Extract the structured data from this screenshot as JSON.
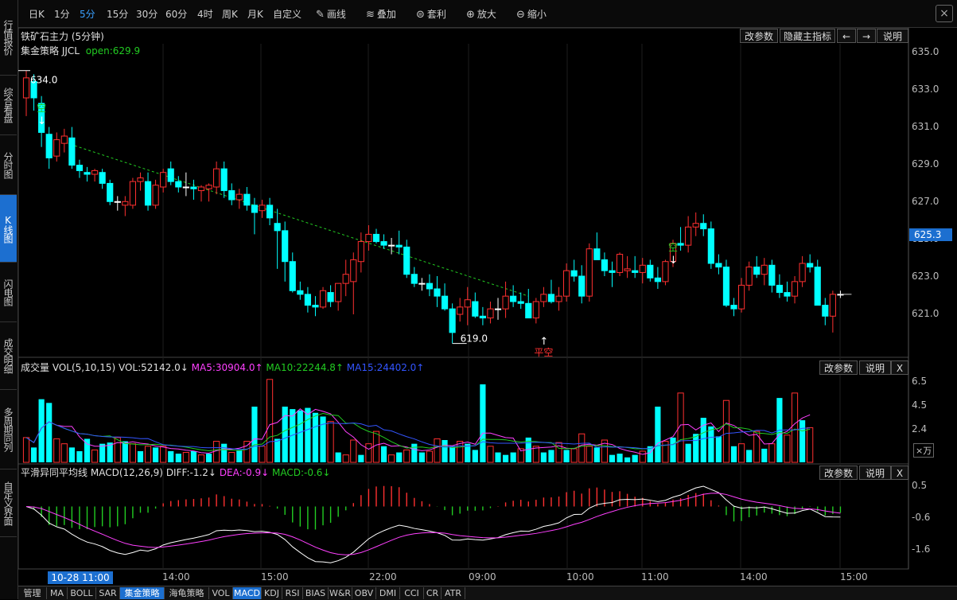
{
  "left_sidebar": [
    "行情报价",
    "综合看盘",
    "分时图",
    "K线图",
    "闪电图",
    "成交明细",
    "多周期同列",
    "自定义界面"
  ],
  "toolbar": {
    "periods": [
      "日K",
      "1分",
      "5分",
      "15分",
      "30分",
      "60分",
      "4时",
      "周K",
      "月K",
      "自定义"
    ],
    "active_period": "5分",
    "tools": [
      {
        "icon": "pencil-icon",
        "label": "画线"
      },
      {
        "icon": "stack-icon",
        "label": "叠加"
      },
      {
        "icon": "arbitrage-icon",
        "label": "套利"
      },
      {
        "icon": "zoom-in-icon",
        "label": "放大"
      },
      {
        "icon": "zoom-out-icon",
        "label": "缩小"
      }
    ],
    "close": "×"
  },
  "main_panel": {
    "title": "铁矿石主力 (5分钟)",
    "strategy_label": "集金策略 JJCL",
    "open_label": "open:629.9",
    "buttons": [
      "改参数",
      "隐藏主指标",
      "←",
      "→",
      "说明"
    ],
    "y_axis": [
      "635.0",
      "633.0",
      "631.0",
      "629.0",
      "627.0",
      "625.0",
      "623.0",
      "621.0"
    ],
    "current_price": "625.3",
    "high_label": "634.0",
    "low_label": "619.0",
    "signals": [
      {
        "text": "空",
        "arrow": "↓",
        "color": "#22cc22"
      },
      {
        "text": "空",
        "arrow": "↓",
        "color": "#22cc22"
      },
      {
        "text": "平空",
        "arrow": "↑",
        "color": "#ff3030"
      }
    ]
  },
  "volume_panel": {
    "name": "成交量",
    "params": "VOL(5,10,15)",
    "vol": "VOL:52142.0↓",
    "ma5": "MA5:30904.0↑",
    "ma10": "MA10:22244.8↑",
    "ma15": "MA15:24402.0↑",
    "buttons": [
      "改参数",
      "说明",
      "X"
    ],
    "y_axis": [
      "6.5",
      "4.5",
      "2.4"
    ],
    "unit": "×万"
  },
  "macd_panel": {
    "name": "平滑异同平均线",
    "params": "MACD(12,26,9)",
    "diff": "DIFF:-1.2↓",
    "dea": "DEA:-0.9↓",
    "macd": "MACD:-0.6↓",
    "buttons": [
      "改参数",
      "说明",
      "X"
    ],
    "y_axis": [
      "0.5",
      "-0.6",
      "-1.6"
    ]
  },
  "time_axis": {
    "cursor": "10-28 11:00",
    "labels": [
      "14:00",
      "15:00",
      "22:00",
      "09:00",
      "10:00",
      "11:00",
      "14:00",
      "15:00"
    ]
  },
  "bottom_tabs": [
    "管理",
    "MA",
    "BOLL",
    "SAR",
    "集金策略",
    "海龟策略",
    "VOL",
    "MACD",
    "KDJ",
    "RSI",
    "BIAS",
    "W&R",
    "OBV",
    "DMI",
    "CCI",
    "CR",
    "ATR"
  ],
  "active_tabs": [
    "集金策略",
    "MACD"
  ],
  "colors": {
    "up": "#ff3030",
    "down": "#00ffff",
    "diff": "#ffffff",
    "dea": "#ff40ff",
    "ma10": "#22cc22",
    "ma15": "#3355ff",
    "accent": "#1c6fd0"
  },
  "chart_data": {
    "type": "candlestick",
    "ohlc": [
      [
        632.5,
        634.0,
        631.5,
        633.6
      ],
      [
        633.4,
        633.8,
        631.8,
        632.5
      ],
      [
        632.2,
        632.6,
        629.8,
        630.6
      ],
      [
        630.5,
        630.9,
        628.6,
        629.2
      ],
      [
        629.3,
        630.6,
        629.0,
        630.2
      ],
      [
        630.0,
        630.8,
        629.5,
        630.4
      ],
      [
        630.3,
        630.9,
        628.6,
        628.8
      ],
      [
        628.8,
        629.1,
        628.1,
        628.5
      ],
      [
        628.4,
        628.7,
        627.9,
        628.3
      ],
      [
        628.3,
        628.6,
        627.9,
        628.5
      ],
      [
        628.4,
        628.6,
        627.5,
        627.8
      ],
      [
        627.8,
        628.0,
        626.6,
        626.8
      ],
      [
        626.8,
        627.1,
        626.3,
        626.8
      ],
      [
        626.6,
        627.1,
        626.0,
        626.8
      ],
      [
        626.6,
        628.1,
        626.4,
        627.9
      ],
      [
        627.9,
        628.4,
        627.4,
        628.1
      ],
      [
        627.9,
        628.4,
        626.3,
        626.6
      ],
      [
        626.6,
        628.0,
        626.4,
        627.7
      ],
      [
        627.6,
        628.6,
        627.3,
        628.4
      ],
      [
        628.6,
        629.0,
        627.7,
        627.9
      ],
      [
        627.9,
        628.2,
        627.3,
        627.6
      ],
      [
        627.6,
        628.4,
        627.1,
        627.6
      ],
      [
        627.6,
        628.0,
        626.9,
        627.5
      ],
      [
        627.4,
        627.7,
        626.8,
        627.6
      ],
      [
        627.5,
        627.8,
        626.8,
        627.7
      ],
      [
        627.6,
        629.0,
        627.2,
        628.6
      ],
      [
        628.6,
        629.0,
        627.0,
        627.4
      ],
      [
        627.4,
        627.8,
        626.6,
        626.9
      ],
      [
        626.9,
        627.5,
        626.4,
        627.2
      ],
      [
        627.2,
        627.6,
        626.3,
        626.6
      ],
      [
        626.6,
        627.0,
        625.0,
        626.2
      ],
      [
        626.3,
        626.9,
        625.9,
        626.6
      ],
      [
        626.6,
        627.0,
        625.5,
        625.9
      ],
      [
        625.6,
        626.4,
        623.1,
        625.2
      ],
      [
        625.2,
        625.7,
        622.4,
        623.5
      ],
      [
        623.5,
        624.0,
        621.8,
        621.9
      ],
      [
        621.9,
        622.4,
        621.4,
        621.7
      ],
      [
        621.7,
        622.1,
        620.7,
        621.1
      ],
      [
        621.1,
        621.6,
        620.5,
        621.0
      ],
      [
        621.0,
        622.1,
        620.9,
        621.9
      ],
      [
        621.8,
        622.2,
        621.0,
        621.3
      ],
      [
        621.3,
        622.3,
        620.8,
        622.3
      ],
      [
        622.3,
        623.6,
        621.6,
        622.8
      ],
      [
        622.4,
        624.0,
        620.6,
        623.6
      ],
      [
        623.5,
        625.1,
        622.9,
        624.6
      ],
      [
        624.6,
        625.5,
        624.1,
        625.0
      ],
      [
        625.0,
        625.3,
        624.5,
        624.6
      ],
      [
        624.6,
        625.0,
        624.2,
        624.4
      ],
      [
        624.4,
        624.8,
        623.9,
        624.4
      ],
      [
        624.4,
        625.2,
        623.9,
        624.3
      ],
      [
        624.3,
        624.7,
        622.6,
        622.8
      ],
      [
        622.8,
        623.2,
        622.1,
        622.3
      ],
      [
        622.3,
        622.6,
        621.9,
        622.3
      ],
      [
        622.3,
        622.8,
        621.6,
        622.0
      ],
      [
        622.0,
        622.7,
        621.0,
        621.6
      ],
      [
        621.6,
        622.3,
        620.8,
        620.9
      ],
      [
        620.9,
        621.2,
        619.0,
        619.6
      ],
      [
        620.6,
        621.5,
        620.2,
        621.0
      ],
      [
        621.0,
        622.1,
        620.0,
        621.4
      ],
      [
        621.3,
        621.8,
        620.4,
        620.5
      ],
      [
        620.5,
        621.0,
        620.0,
        620.4
      ],
      [
        620.4,
        621.3,
        620.1,
        620.9
      ],
      [
        620.9,
        621.5,
        620.3,
        620.9
      ],
      [
        620.9,
        622.4,
        620.4,
        621.6
      ],
      [
        621.6,
        622.2,
        621.0,
        621.3
      ],
      [
        621.3,
        621.8,
        620.9,
        621.2
      ],
      [
        621.2,
        622.0,
        620.4,
        620.4
      ],
      [
        620.4,
        621.5,
        620.1,
        621.3
      ],
      [
        621.3,
        622.1,
        621.0,
        621.7
      ],
      [
        621.7,
        622.5,
        621.2,
        621.3
      ],
      [
        621.3,
        622.1,
        620.8,
        621.6
      ],
      [
        621.6,
        623.4,
        621.3,
        623.0
      ],
      [
        623.0,
        623.6,
        622.4,
        622.7
      ],
      [
        622.7,
        623.3,
        621.2,
        621.6
      ],
      [
        621.6,
        624.5,
        621.3,
        624.2
      ],
      [
        624.2,
        625.1,
        623.6,
        623.6
      ],
      [
        623.6,
        624.0,
        622.7,
        623.0
      ],
      [
        623.0,
        623.5,
        622.1,
        622.9
      ],
      [
        622.9,
        624.0,
        622.7,
        623.9
      ],
      [
        623.0,
        623.8,
        622.6,
        623.1
      ],
      [
        623.0,
        623.8,
        622.6,
        622.9
      ],
      [
        622.9,
        623.7,
        622.3,
        623.3
      ],
      [
        623.3,
        623.6,
        622.4,
        622.6
      ],
      [
        622.6,
        623.2,
        622.0,
        622.4
      ],
      [
        622.4,
        623.6,
        622.2,
        623.5
      ],
      [
        623.5,
        624.7,
        623.2,
        624.5
      ],
      [
        624.5,
        625.4,
        624.1,
        624.4
      ],
      [
        624.4,
        626.0,
        624.0,
        625.4
      ],
      [
        625.4,
        626.2,
        624.9,
        625.6
      ],
      [
        625.6,
        626.1,
        624.9,
        625.3
      ],
      [
        625.3,
        625.7,
        623.1,
        623.4
      ],
      [
        623.4,
        623.9,
        622.8,
        623.2
      ],
      [
        623.2,
        623.6,
        621.0,
        621.1
      ],
      [
        621.1,
        621.5,
        620.5,
        620.9
      ],
      [
        620.9,
        622.6,
        620.7,
        622.2
      ],
      [
        622.2,
        623.5,
        621.9,
        623.2
      ],
      [
        623.2,
        623.8,
        622.6,
        622.8
      ],
      [
        622.8,
        623.7,
        622.2,
        623.3
      ],
      [
        623.3,
        623.6,
        621.8,
        622.2
      ],
      [
        622.2,
        622.8,
        621.5,
        621.8
      ],
      [
        621.8,
        622.4,
        621.3,
        621.6
      ],
      [
        621.6,
        622.7,
        621.2,
        622.4
      ],
      [
        622.4,
        623.8,
        622.1,
        623.4
      ],
      [
        623.4,
        623.9,
        622.9,
        623.2
      ],
      [
        623.2,
        623.6,
        621.5,
        621.1
      ],
      [
        621.1,
        621.5,
        620.0,
        620.5
      ],
      [
        620.5,
        621.9,
        619.6,
        621.7
      ],
      [
        621.7,
        621.9,
        621.5,
        621.7
      ]
    ],
    "volume": [
      {
        "v": 2.0,
        "up": true
      },
      {
        "v": 1.2,
        "up": false
      },
      {
        "v": 5.1,
        "up": false
      },
      {
        "v": 4.8,
        "up": false
      },
      {
        "v": 1.9,
        "up": true
      },
      {
        "v": 1.5,
        "up": true
      },
      {
        "v": 1.2,
        "up": false
      },
      {
        "v": 0.9,
        "up": false
      },
      {
        "v": 1.9,
        "up": false
      },
      {
        "v": 1.0,
        "up": true
      },
      {
        "v": 1.5,
        "up": false
      },
      {
        "v": 1.6,
        "up": false
      },
      {
        "v": 2.0,
        "up": true
      },
      {
        "v": 1.7,
        "up": false
      },
      {
        "v": 1.5,
        "up": true
      },
      {
        "v": 0.9,
        "up": false
      },
      {
        "v": 1.3,
        "up": true
      },
      {
        "v": 1.2,
        "up": false
      },
      {
        "v": 1.3,
        "up": true
      },
      {
        "v": 0.9,
        "up": false
      },
      {
        "v": 0.7,
        "up": false
      },
      {
        "v": 0.8,
        "up": true
      },
      {
        "v": 0.9,
        "up": false
      },
      {
        "v": 0.6,
        "up": true
      },
      {
        "v": 0.7,
        "up": false
      },
      {
        "v": 1.7,
        "up": true
      },
      {
        "v": 1.5,
        "up": false
      },
      {
        "v": 0.8,
        "up": true
      },
      {
        "v": 1.0,
        "up": false
      },
      {
        "v": 1.7,
        "up": true
      },
      {
        "v": 4.5,
        "up": false
      },
      {
        "v": 1.3,
        "up": true
      },
      {
        "v": 6.7,
        "up": true
      },
      {
        "v": 1.9,
        "up": false
      },
      {
        "v": 4.5,
        "up": false
      },
      {
        "v": 4.3,
        "up": false
      },
      {
        "v": 4.2,
        "up": false
      },
      {
        "v": 4.4,
        "up": false
      },
      {
        "v": 4.0,
        "up": false
      },
      {
        "v": 3.7,
        "up": false
      },
      {
        "v": 3.3,
        "up": true
      },
      {
        "v": 0.8,
        "up": false
      },
      {
        "v": 0.6,
        "up": true
      },
      {
        "v": 1.8,
        "up": true
      },
      {
        "v": 0.6,
        "up": false
      },
      {
        "v": 1.5,
        "up": true
      },
      {
        "v": 2.5,
        "up": true
      },
      {
        "v": 1.3,
        "up": false
      },
      {
        "v": 0.6,
        "up": true
      },
      {
        "v": 0.8,
        "up": false
      },
      {
        "v": 1.0,
        "up": true
      },
      {
        "v": 1.5,
        "up": false
      },
      {
        "v": 0.8,
        "up": false
      },
      {
        "v": 0.9,
        "up": true
      },
      {
        "v": 1.9,
        "up": true
      },
      {
        "v": 1.8,
        "up": false
      },
      {
        "v": 1.3,
        "up": false
      },
      {
        "v": 1.7,
        "up": true
      },
      {
        "v": 1.5,
        "up": false
      },
      {
        "v": 1.0,
        "up": false
      },
      {
        "v": 6.3,
        "up": false
      },
      {
        "v": 1.3,
        "up": true
      },
      {
        "v": 0.8,
        "up": false
      },
      {
        "v": 0.6,
        "up": false
      },
      {
        "v": 0.8,
        "up": false
      },
      {
        "v": 1.1,
        "up": true
      },
      {
        "v": 2.0,
        "up": false
      },
      {
        "v": 1.3,
        "up": true
      },
      {
        "v": 0.8,
        "up": false
      },
      {
        "v": 1.0,
        "up": false
      },
      {
        "v": 1.6,
        "up": true
      },
      {
        "v": 1.0,
        "up": false
      },
      {
        "v": 1.1,
        "up": true
      },
      {
        "v": 2.3,
        "up": true
      },
      {
        "v": 1.3,
        "up": true
      },
      {
        "v": 1.2,
        "up": false
      },
      {
        "v": 1.8,
        "up": true
      },
      {
        "v": 0.6,
        "up": false
      },
      {
        "v": 0.7,
        "up": false
      },
      {
        "v": 0.4,
        "up": false
      },
      {
        "v": 0.6,
        "up": false
      },
      {
        "v": 0.9,
        "up": true
      },
      {
        "v": 1.3,
        "up": false
      },
      {
        "v": 4.5,
        "up": false
      },
      {
        "v": 1.7,
        "up": true
      },
      {
        "v": 2.0,
        "up": false
      },
      {
        "v": 5.6,
        "up": true
      },
      {
        "v": 1.5,
        "up": false
      },
      {
        "v": 2.3,
        "up": false
      },
      {
        "v": 3.6,
        "up": false
      },
      {
        "v": 2.9,
        "up": false
      },
      {
        "v": 2.1,
        "up": false
      },
      {
        "v": 5.0,
        "up": true
      },
      {
        "v": 1.3,
        "up": false
      },
      {
        "v": 1.5,
        "up": true
      },
      {
        "v": 1.0,
        "up": false
      },
      {
        "v": 2.5,
        "up": true
      },
      {
        "v": 1.1,
        "up": false
      },
      {
        "v": 1.5,
        "up": true
      },
      {
        "v": 5.2,
        "up": false
      },
      {
        "v": 2.2,
        "up": true
      },
      {
        "v": 5.6,
        "up": true
      },
      {
        "v": 3.4,
        "up": false
      },
      {
        "v": 2.8,
        "up": true
      }
    ],
    "vol_ylim": [
      0,
      7.2
    ],
    "price_ylim": [
      618.5,
      635.3
    ],
    "macd_ylim": [
      -2.1,
      1.0
    ]
  }
}
